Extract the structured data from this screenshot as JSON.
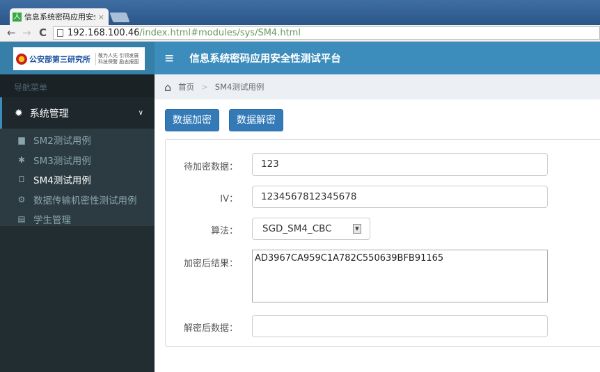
{
  "browser": {
    "tab_title": "信息系统密码应用安全性测",
    "url_host": "192.168.100.46",
    "url_path": "/index.html#modules/sys/SM4.html",
    "back": "←",
    "forward": "→",
    "reload": "C"
  },
  "logo": {
    "name": "公安部第三研究所",
    "slogan1": "敬为人先 引领发展",
    "slogan2": "科技保警 励志报国"
  },
  "header": {
    "title": "信息系统密码应用安全性测试平台",
    "menu_icon": "≡"
  },
  "sidebar": {
    "nav_label": "导航菜单",
    "group": "系统管理",
    "items": [
      {
        "label": "SM2测试用例",
        "icon": "lock-icon"
      },
      {
        "label": "SM3测试用例",
        "icon": "bug-icon"
      },
      {
        "label": "SM4测试用例",
        "icon": "bookmark-icon",
        "active": true
      },
      {
        "label": "数据传输机密性测试用例",
        "icon": "gear-icon"
      },
      {
        "label": "学生管理",
        "icon": "card-icon"
      }
    ]
  },
  "breadcrumb": {
    "home": "首页",
    "sep": ">",
    "current": "SM4测试用例"
  },
  "buttons": {
    "encrypt": "数据加密",
    "decrypt": "数据解密"
  },
  "form": {
    "plain_label": "待加密数据：",
    "plain_value": "123",
    "iv_label": "IV：",
    "iv_value": "1234567812345678",
    "algo_label": "算法：",
    "algo_value": "SGD_SM4_CBC",
    "cipher_label": "加密后结果：",
    "cipher_value": "AD3967CA959C1A782C550639BFB91165",
    "decrypted_label": "解密后数据：",
    "decrypted_value": ""
  },
  "colors": {
    "primary": "#337ab7",
    "header": "#3c8dbc",
    "sidebar": "#222d32"
  }
}
